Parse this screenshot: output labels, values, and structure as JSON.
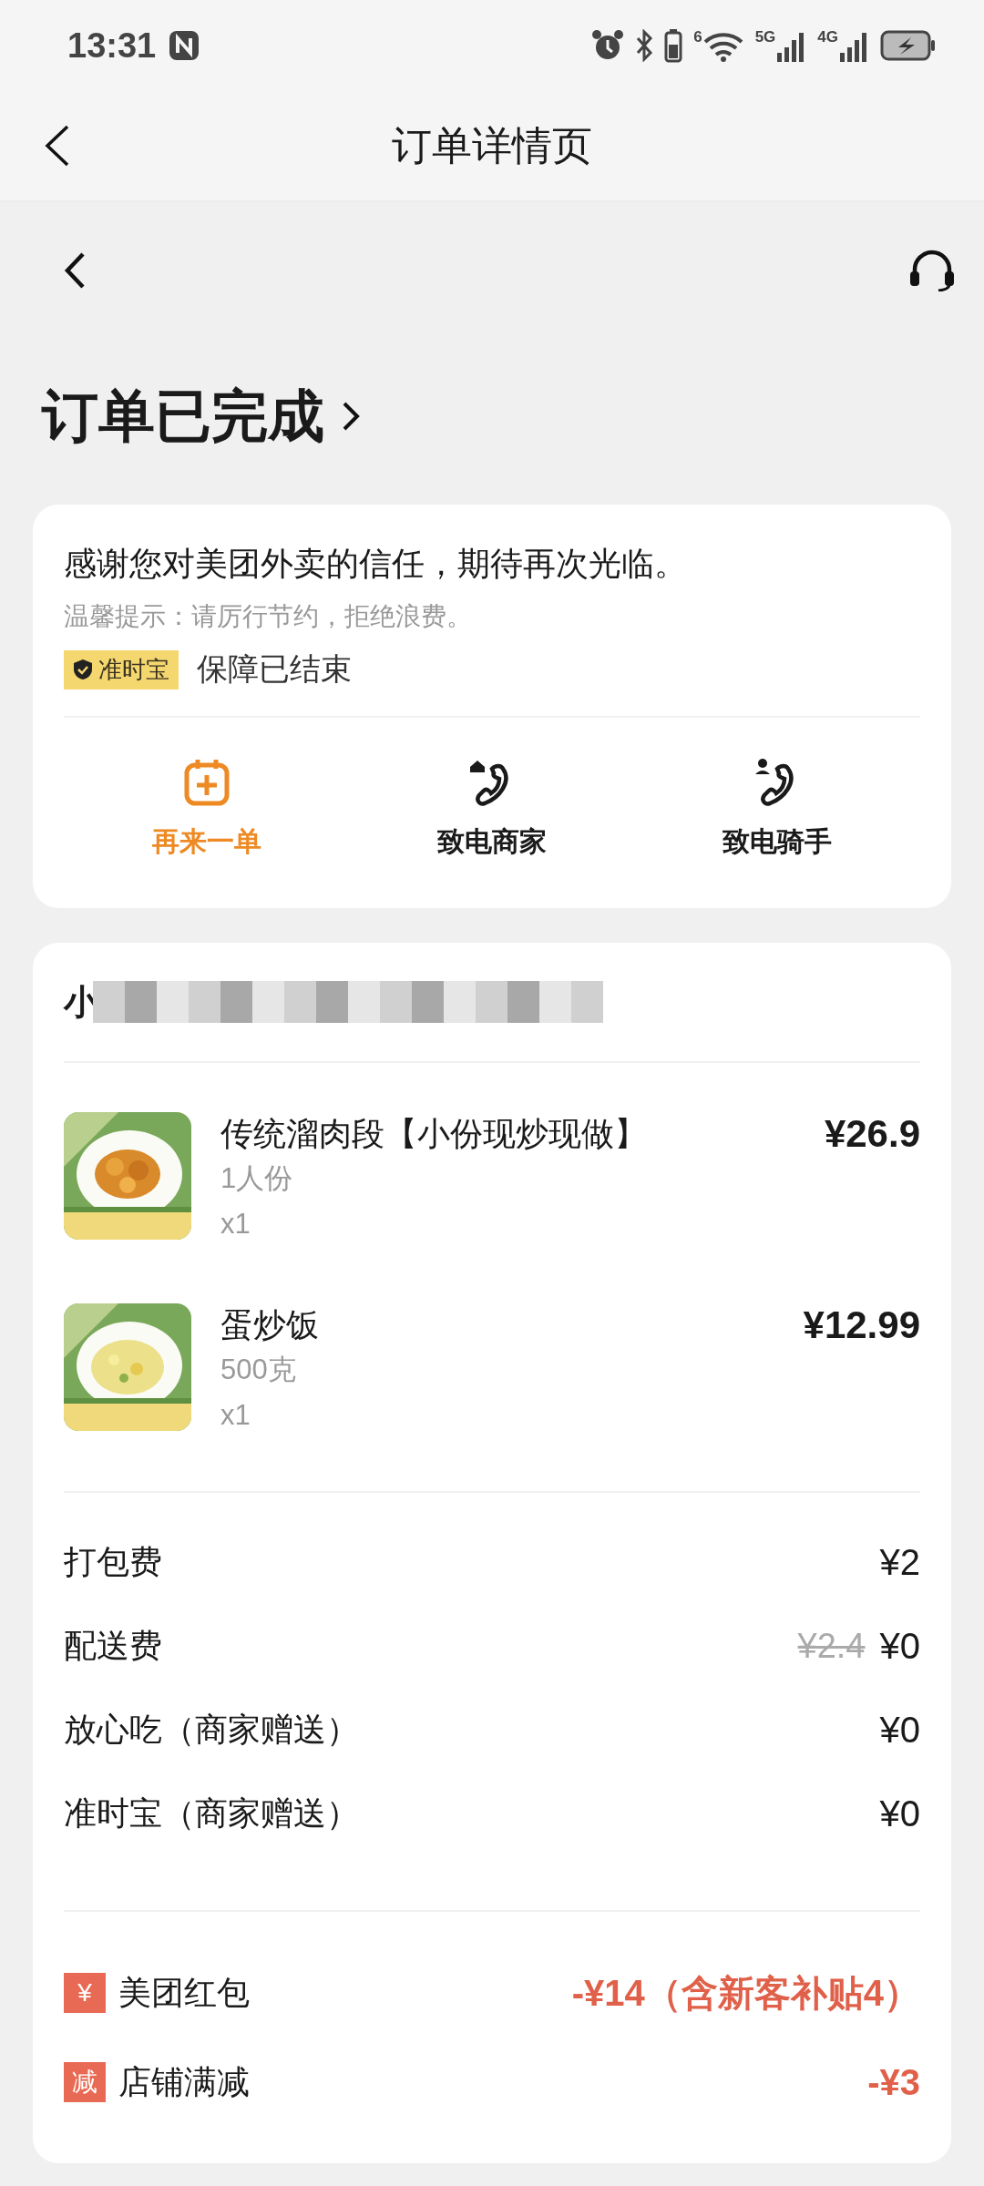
{
  "status_bar": {
    "time": "13:31",
    "wifi_label": "6",
    "networks": [
      "5G",
      "4G"
    ]
  },
  "header": {
    "title": "订单详情页"
  },
  "order_status": {
    "title": "订单已完成"
  },
  "notice": {
    "message": "感谢您对美团外卖的信任，期待再次光临。",
    "tip": "温馨提示：请厉行节约，拒绝浪费。",
    "badge": "准时宝",
    "badge_status": "保障已结束"
  },
  "actions": [
    {
      "kind": "reorder",
      "label": "再来一单",
      "highlighted": true
    },
    {
      "kind": "call_merchant",
      "label": "致电商家",
      "highlighted": false
    },
    {
      "kind": "call_rider",
      "label": "致电骑手",
      "highlighted": false
    }
  ],
  "store": {
    "name": "小",
    "items": [
      {
        "name": "传统溜肉段【小份现炒现做】",
        "spec": "1人份",
        "quantity": "x1",
        "price": "¥26.9"
      },
      {
        "name": "蛋炒饭",
        "spec": "500克",
        "quantity": "x1",
        "price": "¥12.99"
      }
    ]
  },
  "fees": [
    {
      "label": "打包费",
      "price": "¥2"
    },
    {
      "label": "配送费",
      "original_price": "¥2.4",
      "price": "¥0"
    },
    {
      "label": "放心吃（商家赠送）",
      "price": "¥0"
    },
    {
      "label": "准时宝（商家赠送）",
      "price": "¥0"
    }
  ],
  "discounts": [
    {
      "icon": "¥",
      "label": "美团红包",
      "amount": "-¥14（含新客补贴4）"
    },
    {
      "icon": "减",
      "label": "店铺满减",
      "amount": "-¥3"
    }
  ]
}
